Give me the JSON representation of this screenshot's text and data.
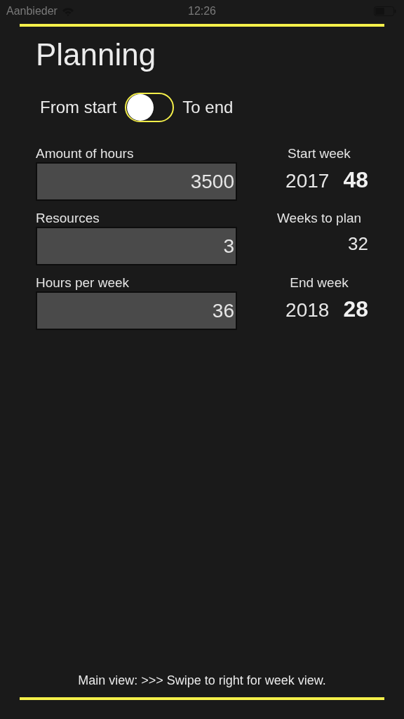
{
  "status_bar": {
    "carrier": "Aanbieder",
    "time": "12:26"
  },
  "title": "Planning",
  "mode_toggle": {
    "left_label": "From start",
    "right_label": "To end",
    "on": false
  },
  "rows": [
    {
      "label": "Amount of hours",
      "value": "3500",
      "side": {
        "kind": "year_week",
        "label": "Start week",
        "year": "2017",
        "week": "48"
      }
    },
    {
      "label": "Resources",
      "value": "3",
      "side": {
        "kind": "single",
        "label": "Weeks to plan",
        "value": "32"
      }
    },
    {
      "label": "Hours per week",
      "value": "36",
      "side": {
        "kind": "year_week",
        "label": "End week",
        "year": "2018",
        "week": "28"
      }
    }
  ],
  "footer": "Main view: >>> Swipe to right for week view."
}
